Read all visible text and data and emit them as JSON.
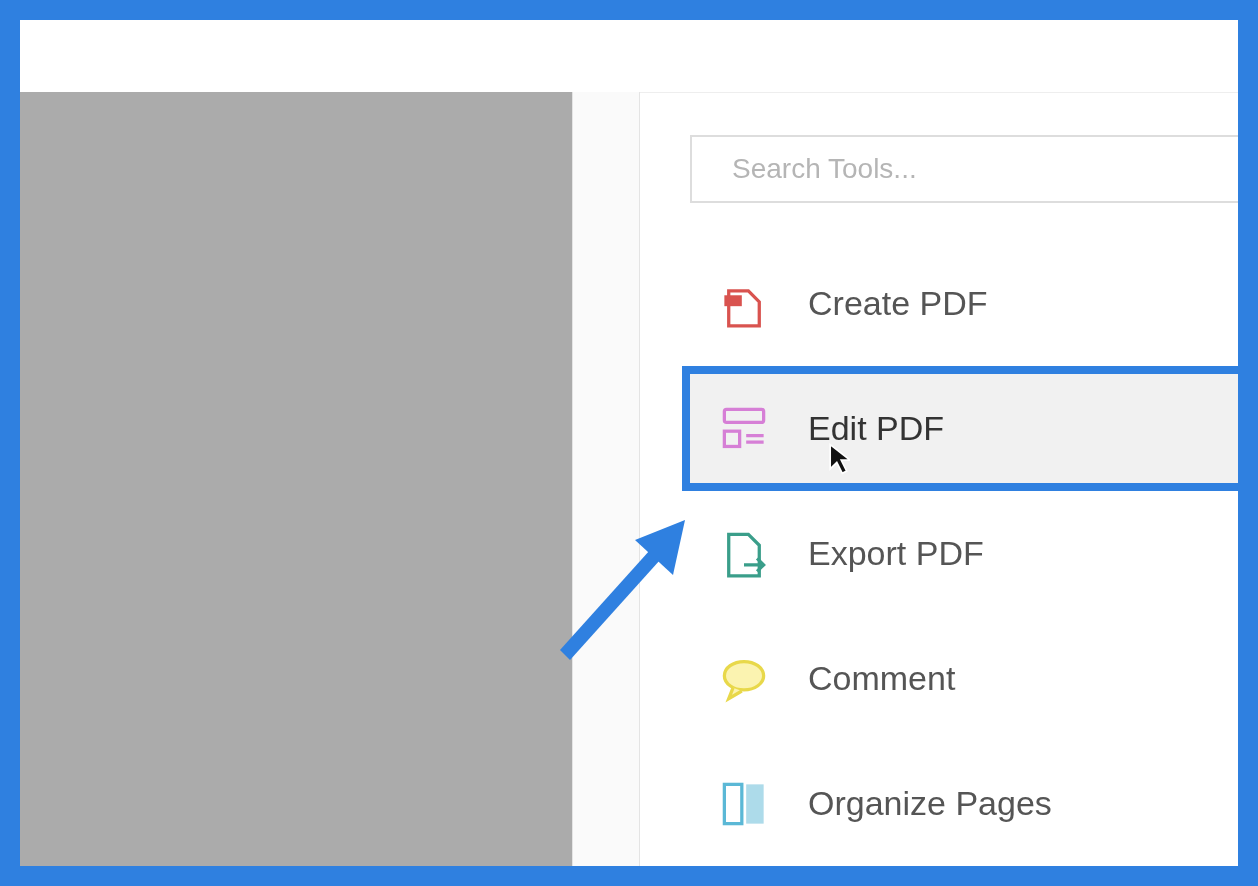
{
  "search": {
    "placeholder": "Search Tools..."
  },
  "tools": [
    {
      "label": "Create PDF",
      "kind": "create",
      "color": "#d9534f",
      "selected": false
    },
    {
      "label": "Edit PDF",
      "kind": "edit",
      "color": "#d67fd6",
      "selected": true
    },
    {
      "label": "Export PDF",
      "kind": "export",
      "color": "#3a9e8a",
      "selected": false
    },
    {
      "label": "Comment",
      "kind": "comment",
      "color": "#e8d84a",
      "selected": false
    },
    {
      "label": "Organize Pages",
      "kind": "organize",
      "color": "#5bb8d6",
      "selected": false
    }
  ]
}
